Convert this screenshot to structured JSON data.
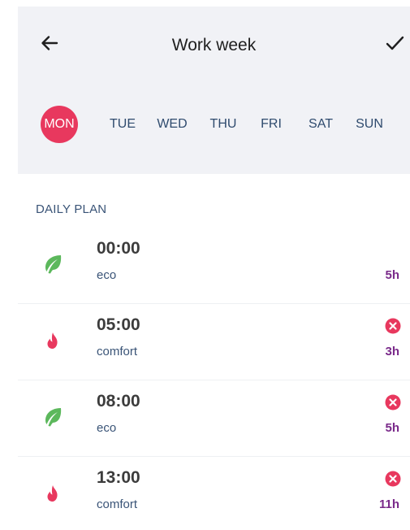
{
  "header": {
    "title": "Work week",
    "back_icon": "arrow-left-icon",
    "confirm_icon": "check-icon"
  },
  "days": [
    {
      "label": "MON",
      "selected": true
    },
    {
      "label": "TUE",
      "selected": false
    },
    {
      "label": "WED",
      "selected": false
    },
    {
      "label": "THU",
      "selected": false
    },
    {
      "label": "FRI",
      "selected": false
    },
    {
      "label": "SAT",
      "selected": false
    },
    {
      "label": "SUN",
      "selected": false
    }
  ],
  "daily_plan": {
    "label": "DAILY PLAN",
    "items": [
      {
        "time": "00:00",
        "mode": "eco",
        "icon": "leaf-icon",
        "duration": "5h",
        "removable": false
      },
      {
        "time": "05:00",
        "mode": "comfort",
        "icon": "flame-icon",
        "duration": "3h",
        "removable": true
      },
      {
        "time": "08:00",
        "mode": "eco",
        "icon": "leaf-icon",
        "duration": "5h",
        "removable": true
      },
      {
        "time": "13:00",
        "mode": "comfort",
        "icon": "flame-icon",
        "duration": "11h",
        "removable": true
      }
    ]
  },
  "colors": {
    "accent": "#e8385e",
    "eco": "#5cb85c",
    "comfort": "#e8385e",
    "duration": "#7a2a8a",
    "header_bg": "#f1f2f6",
    "secondary_text": "#3a5477"
  }
}
